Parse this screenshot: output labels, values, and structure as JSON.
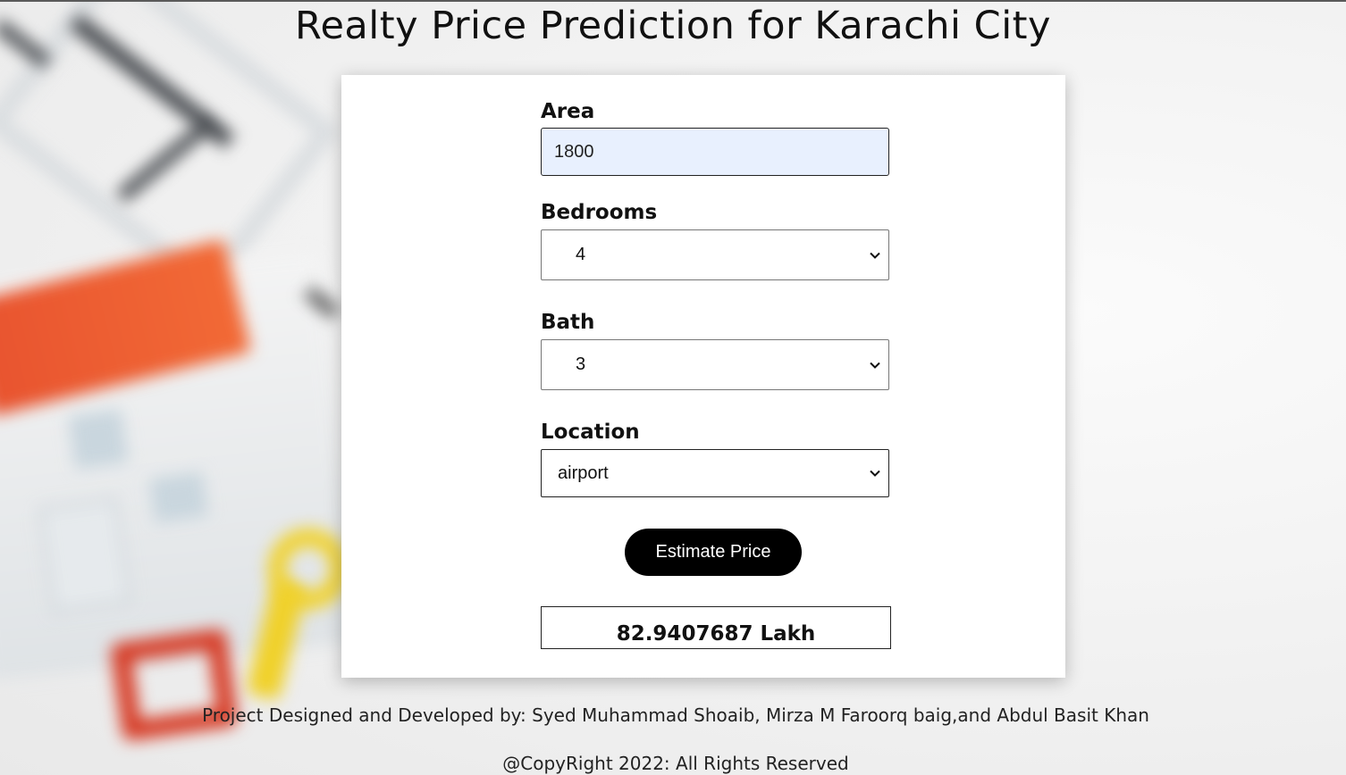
{
  "page": {
    "title": "Realty Price Prediction for Karachi City"
  },
  "form": {
    "area": {
      "label": "Area",
      "value": "1800"
    },
    "bedrooms": {
      "label": "Bedrooms",
      "selected": "4"
    },
    "bath": {
      "label": "Bath",
      "selected": "3"
    },
    "location": {
      "label": "Location",
      "selected": "airport"
    },
    "submit_label": "Estimate Price",
    "result": "82.9407687 Lakh"
  },
  "footer": {
    "credits": "Project Designed and Developed by: Syed Muhammad Shoaib, Mirza M Faroorq baig,and Abdul Basit Khan",
    "copyright": "@CopyRight 2022: All Rights Reserved"
  },
  "icons": {
    "dropdown": "chevron-down-icon"
  },
  "colors": {
    "button_bg": "#000000",
    "button_text": "#ffffff",
    "autofill_input_bg": "#e8f0fe",
    "card_bg": "#ffffff"
  }
}
